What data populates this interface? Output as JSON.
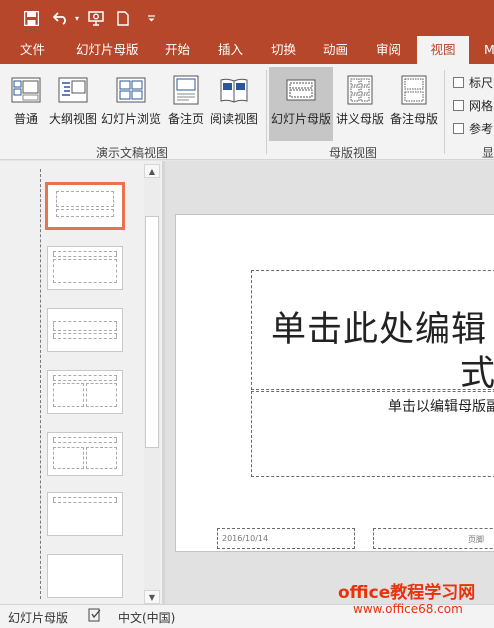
{
  "quick_access": {
    "save_icon": "save-icon",
    "undo_icon": "undo-icon",
    "slideshow_icon": "start-slideshow-icon",
    "new_icon": "new-document-icon",
    "customize_icon": "customize-qat-icon"
  },
  "tabs": [
    {
      "label": "文件"
    },
    {
      "label": "幻灯片母版"
    },
    {
      "label": "开始"
    },
    {
      "label": "插入"
    },
    {
      "label": "切换"
    },
    {
      "label": "动画"
    },
    {
      "label": "审阅"
    },
    {
      "label": "视图"
    },
    {
      "label": "M"
    }
  ],
  "ribbon": {
    "buttons": [
      {
        "label": "普通"
      },
      {
        "label": "大纲视图"
      },
      {
        "label": "幻灯片浏览"
      },
      {
        "label": "备注页"
      },
      {
        "label": "阅读视图"
      },
      {
        "label": "幻灯片母版"
      },
      {
        "label": "讲义母版"
      },
      {
        "label": "备注母版"
      }
    ],
    "groups": [
      {
        "label": "演示文稿视图"
      },
      {
        "label": "母版视图"
      },
      {
        "label": "显"
      }
    ],
    "checks": [
      {
        "label": "标尺"
      },
      {
        "label": "网格"
      },
      {
        "label": "参考"
      }
    ]
  },
  "slide": {
    "title_line1": "单击此处编辑",
    "title_line2": "式",
    "subtitle": "单击以编辑母版副",
    "date": "2016/10/14",
    "footer": "页脚"
  },
  "statusbar": {
    "view": "幻灯片母版",
    "language": "中文(中国)"
  },
  "watermark": {
    "line1": "office教程学习网",
    "line2": "www.office68.com"
  },
  "colors": {
    "accent": "#b7472a",
    "selection_border": "#e8734f"
  }
}
